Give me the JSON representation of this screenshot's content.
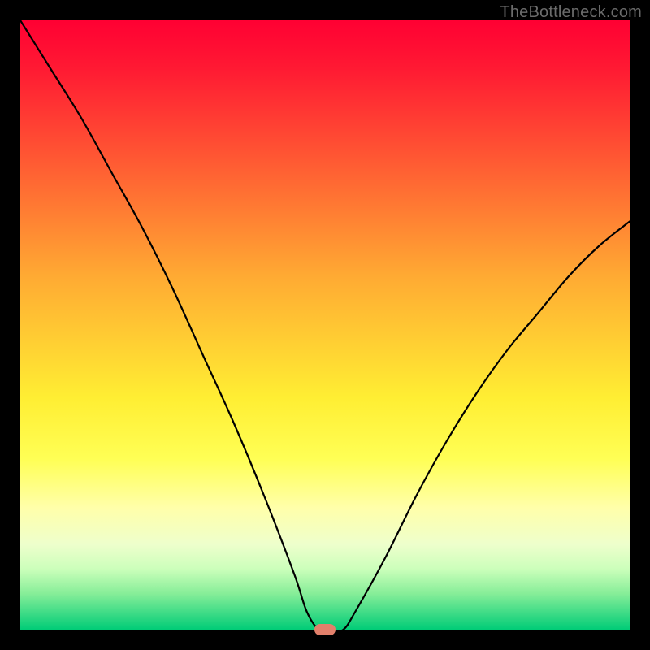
{
  "watermark": "TheBottleneck.com",
  "chart_data": {
    "type": "line",
    "title": "",
    "xlabel": "",
    "ylabel": "",
    "xlim": [
      0,
      100
    ],
    "ylim": [
      0,
      100
    ],
    "grid": false,
    "series": [
      {
        "name": "bottleneck-curve",
        "x": [
          0,
          5,
          10,
          15,
          20,
          25,
          30,
          35,
          40,
          45,
          47,
          49,
          51,
          53,
          55,
          60,
          65,
          70,
          75,
          80,
          85,
          90,
          95,
          100
        ],
        "values": [
          100,
          92,
          84,
          75,
          66,
          56,
          45,
          34,
          22,
          9,
          3,
          0,
          0,
          0,
          3,
          12,
          22,
          31,
          39,
          46,
          52,
          58,
          63,
          67
        ]
      }
    ],
    "marker": {
      "x": 50,
      "y": 0,
      "color": "#e2806b"
    },
    "background_gradient": {
      "top": "#ff0033",
      "mid": "#ffee33",
      "bottom": "#00cc77"
    }
  }
}
